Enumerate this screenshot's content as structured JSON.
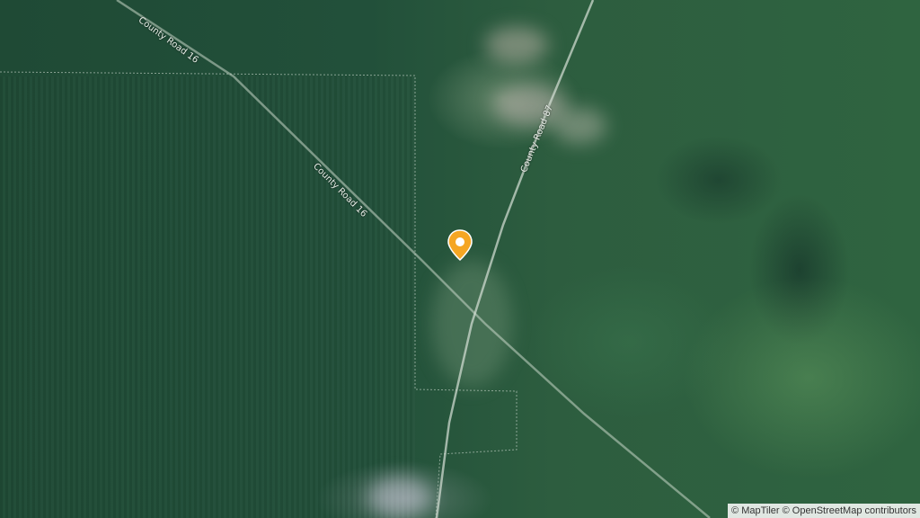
{
  "map": {
    "roads": [
      {
        "name": "County Road 16",
        "label": "County Road 16"
      },
      {
        "name": "County Road 16",
        "label": "County Road 16"
      },
      {
        "name": "County Road 87",
        "label": "County Road 87"
      }
    ],
    "marker": {
      "icon": "location-pin-icon",
      "color": "#f5a623"
    },
    "attribution": "© MapTiler © OpenStreetMap contributors"
  }
}
